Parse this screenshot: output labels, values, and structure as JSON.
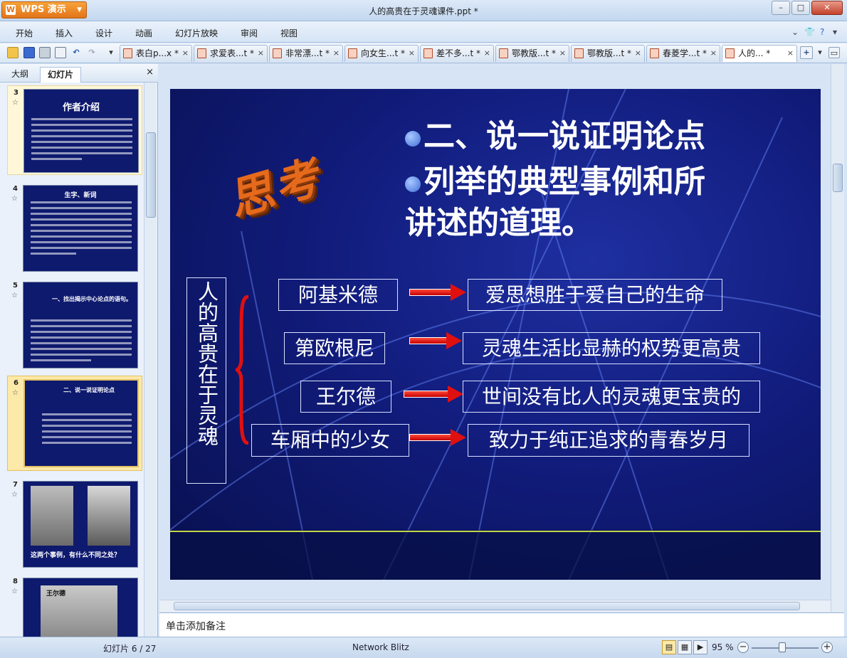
{
  "window": {
    "app_name": "WPS 演示",
    "title": "人的高贵在于灵魂课件.ppt *"
  },
  "menu": {
    "items": [
      "开始",
      "插入",
      "设计",
      "动画",
      "幻灯片放映",
      "审阅",
      "视图"
    ]
  },
  "doc_tabs": [
    {
      "label": "表白p...x *",
      "close": "×"
    },
    {
      "label": "求爱表...t *",
      "close": "×"
    },
    {
      "label": "非常漂...t *",
      "close": "×"
    },
    {
      "label": "向女生...t *",
      "close": "×"
    },
    {
      "label": "差不多...t *",
      "close": "×"
    },
    {
      "label": "鄂教版...t *",
      "close": "×"
    },
    {
      "label": "鄂教版...t *",
      "close": "×"
    },
    {
      "label": "春菱学...t *",
      "close": "×"
    },
    {
      "label": "人的... *",
      "close": "×"
    }
  ],
  "left_panel": {
    "tabs": [
      "大纲",
      "幻灯片"
    ],
    "close": "×",
    "thumbs": [
      {
        "num": "3",
        "title": "作者介绍"
      },
      {
        "num": "4",
        "title": "生字、新词"
      },
      {
        "num": "5",
        "title": "一、找出揭示中心论点的语句。"
      },
      {
        "num": "6",
        "title": "二、说一说证明论点"
      },
      {
        "num": "7",
        "title": "这两个事例，有什么不同之处？"
      },
      {
        "num": "8",
        "title": "王尔德"
      }
    ]
  },
  "slide": {
    "think_text": "思考",
    "heading1": "二、说一说证明论点",
    "heading2": "列举的典型事例和所",
    "heading3": "讲述的道理。",
    "vertical_label": "人的高贵在于灵魂",
    "rows": [
      {
        "name": "阿基米德",
        "desc": "爱思想胜于爱自己的生命"
      },
      {
        "name": "第欧根尼",
        "desc": "灵魂生活比显赫的权势更高贵"
      },
      {
        "name": "王尔德",
        "desc": "世间没有比人的灵魂更宝贵的"
      },
      {
        "name": "车厢中的少女",
        "desc": "致力于纯正追求的青春岁月"
      }
    ]
  },
  "notes": {
    "placeholder": "单击添加备注"
  },
  "status": {
    "slide_counter": "幻灯片 6 / 27",
    "theme": "Network Blitz",
    "zoom": "95 %"
  }
}
